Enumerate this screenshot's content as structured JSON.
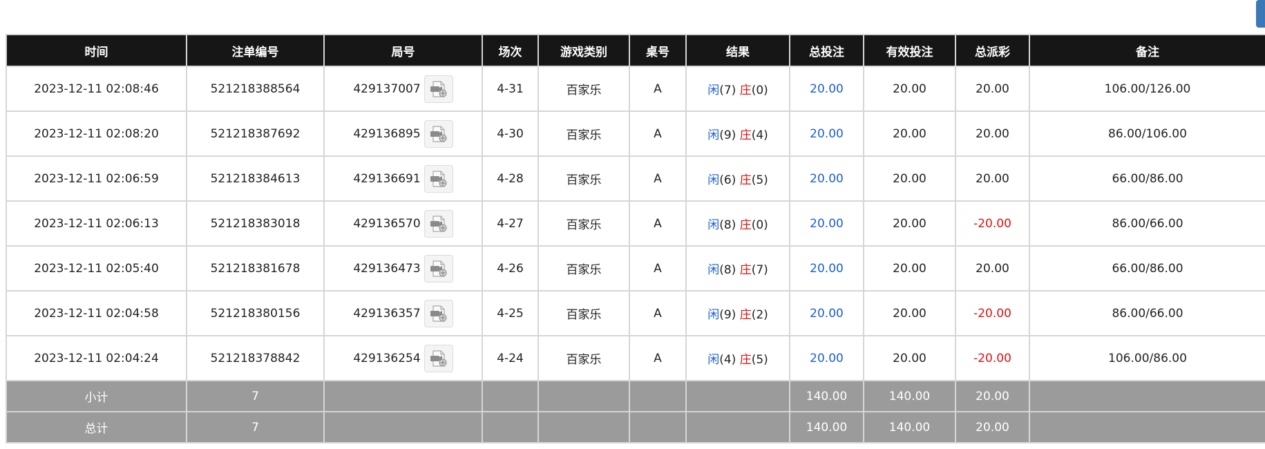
{
  "table": {
    "headers": [
      "时间",
      "注单编号",
      "局号",
      "场次",
      "游戏类别",
      "桌号",
      "结果",
      "总投注",
      "有效投注",
      "总派彩",
      "备注"
    ],
    "rows": [
      {
        "time": "2023-12-11 02:08:46",
        "bet_no": "521218388564",
        "round_no": "429137007",
        "session": "4-31",
        "game": "百家乐",
        "table_no": "A",
        "player_label": "闲",
        "player_score": "(7)",
        "banker_label": "庄",
        "banker_score": "(0)",
        "total_bet": "20.00",
        "valid_bet": "20.00",
        "payout": "20.00",
        "payout_negative": false,
        "remark": "106.00/126.00"
      },
      {
        "time": "2023-12-11 02:08:20",
        "bet_no": "521218387692",
        "round_no": "429136895",
        "session": "4-30",
        "game": "百家乐",
        "table_no": "A",
        "player_label": "闲",
        "player_score": "(9)",
        "banker_label": "庄",
        "banker_score": "(4)",
        "total_bet": "20.00",
        "valid_bet": "20.00",
        "payout": "20.00",
        "payout_negative": false,
        "remark": "86.00/106.00"
      },
      {
        "time": "2023-12-11 02:06:59",
        "bet_no": "521218384613",
        "round_no": "429136691",
        "session": "4-28",
        "game": "百家乐",
        "table_no": "A",
        "player_label": "闲",
        "player_score": "(6)",
        "banker_label": "庄",
        "banker_score": "(5)",
        "total_bet": "20.00",
        "valid_bet": "20.00",
        "payout": "20.00",
        "payout_negative": false,
        "remark": "66.00/86.00"
      },
      {
        "time": "2023-12-11 02:06:13",
        "bet_no": "521218383018",
        "round_no": "429136570",
        "session": "4-27",
        "game": "百家乐",
        "table_no": "A",
        "player_label": "闲",
        "player_score": "(8)",
        "banker_label": "庄",
        "banker_score": "(0)",
        "total_bet": "20.00",
        "valid_bet": "20.00",
        "payout": "-20.00",
        "payout_negative": true,
        "remark": "86.00/66.00"
      },
      {
        "time": "2023-12-11 02:05:40",
        "bet_no": "521218381678",
        "round_no": "429136473",
        "session": "4-26",
        "game": "百家乐",
        "table_no": "A",
        "player_label": "闲",
        "player_score": "(8)",
        "banker_label": "庄",
        "banker_score": "(7)",
        "total_bet": "20.00",
        "valid_bet": "20.00",
        "payout": "20.00",
        "payout_negative": false,
        "remark": "66.00/86.00"
      },
      {
        "time": "2023-12-11 02:04:58",
        "bet_no": "521218380156",
        "round_no": "429136357",
        "session": "4-25",
        "game": "百家乐",
        "table_no": "A",
        "player_label": "闲",
        "player_score": "(9)",
        "banker_label": "庄",
        "banker_score": "(2)",
        "total_bet": "20.00",
        "valid_bet": "20.00",
        "payout": "-20.00",
        "payout_negative": true,
        "remark": "86.00/66.00"
      },
      {
        "time": "2023-12-11 02:04:24",
        "bet_no": "521218378842",
        "round_no": "429136254",
        "session": "4-24",
        "game": "百家乐",
        "table_no": "A",
        "player_label": "闲",
        "player_score": "(4)",
        "banker_label": "庄",
        "banker_score": "(5)",
        "total_bet": "20.00",
        "valid_bet": "20.00",
        "payout": "-20.00",
        "payout_negative": true,
        "remark": "106.00/86.00"
      }
    ],
    "footer": [
      {
        "label": "小计",
        "count": "7",
        "total_bet": "140.00",
        "valid_bet": "140.00",
        "payout": "20.00"
      },
      {
        "label": "总计",
        "count": "7",
        "total_bet": "140.00",
        "valid_bet": "140.00",
        "payout": "20.00"
      }
    ]
  },
  "icons": {
    "replay": "video-replay-icon"
  },
  "colors": {
    "header_bg": "#161616",
    "footer_bg": "#9b9b9b",
    "player_blue": "#1a5fd6",
    "banker_red": "#e01010",
    "negative_red": "#e01010",
    "total_bet_blue": "#1a5fd6"
  }
}
